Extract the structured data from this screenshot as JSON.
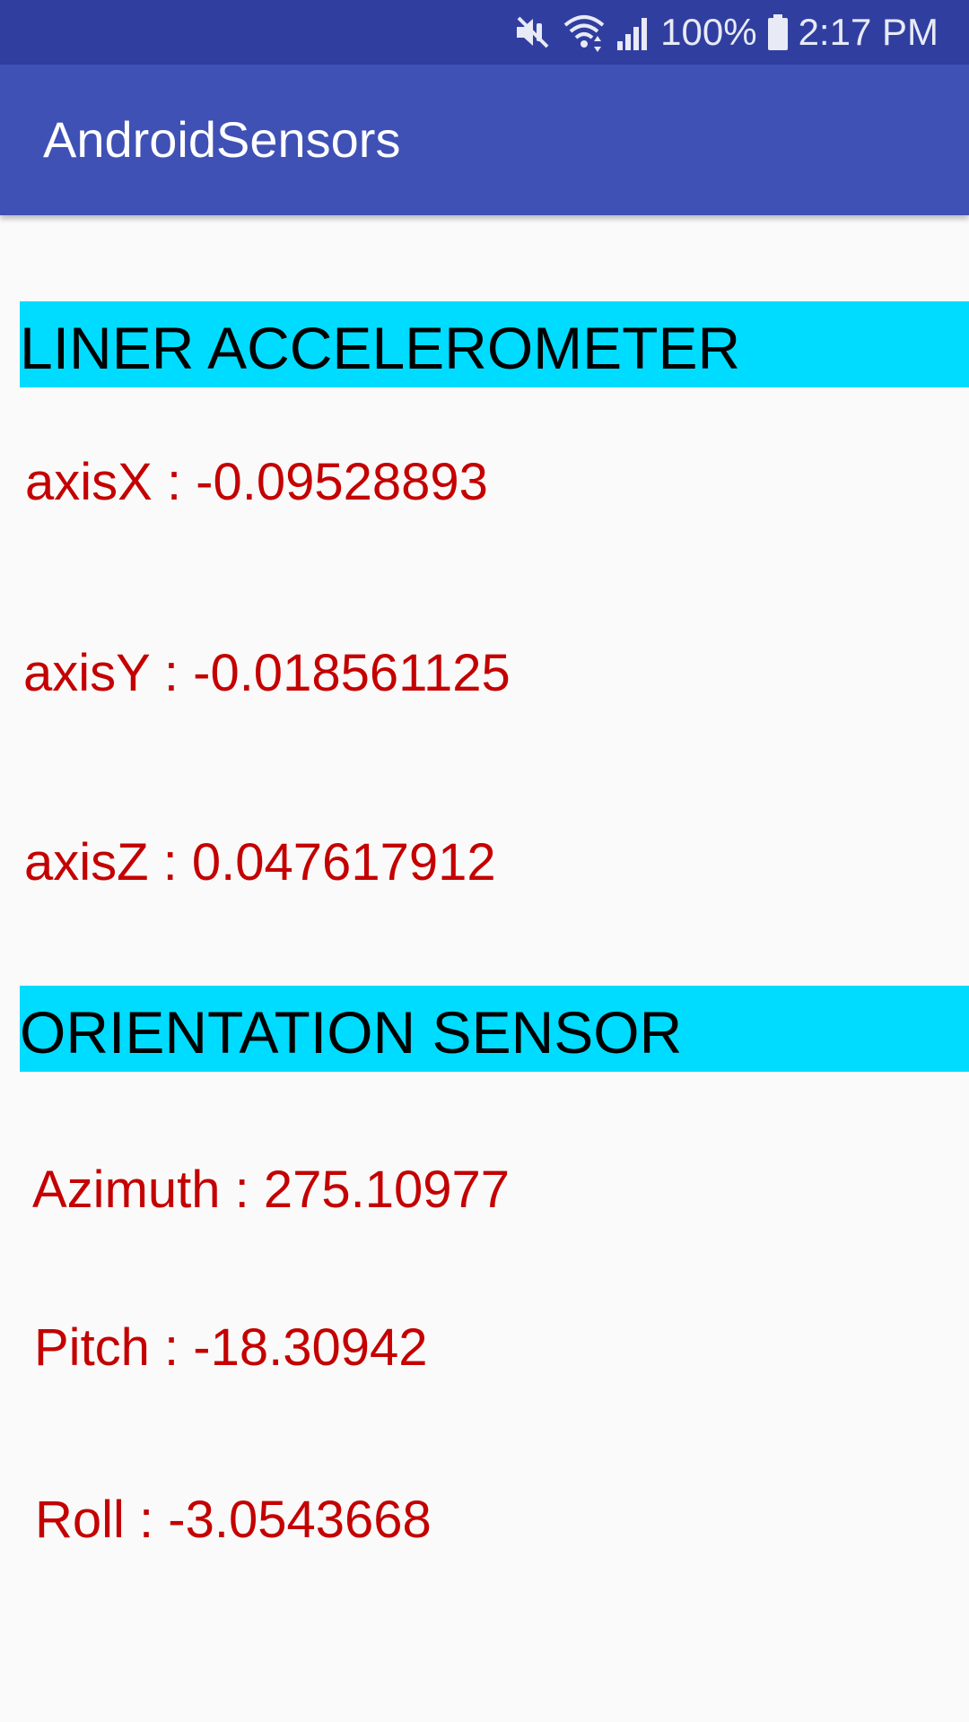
{
  "status_bar": {
    "battery": "100%",
    "time": "2:17 PM",
    "icons": [
      "mute-vibrate-icon",
      "wifi-icon",
      "signal-icon",
      "battery-icon"
    ]
  },
  "app_bar": {
    "title": "AndroidSensors"
  },
  "accelerometer": {
    "header": "LINER ACCELEROMETER",
    "axis_x": "axisX : -0.09528893",
    "axis_y": "axisY : -0.018561125",
    "axis_z": "axisZ : 0.047617912"
  },
  "orientation": {
    "header": "ORIENTATION SENSOR",
    "azimuth": "Azimuth : 275.10977",
    "pitch": "Pitch : -18.30942",
    "roll": "Roll : -3.0543668"
  },
  "colors": {
    "status_bar": "#303f9f",
    "app_bar": "#3f51b5",
    "section_header": "#00dcff",
    "reading_text": "#c40000",
    "background": "#fafafa"
  }
}
